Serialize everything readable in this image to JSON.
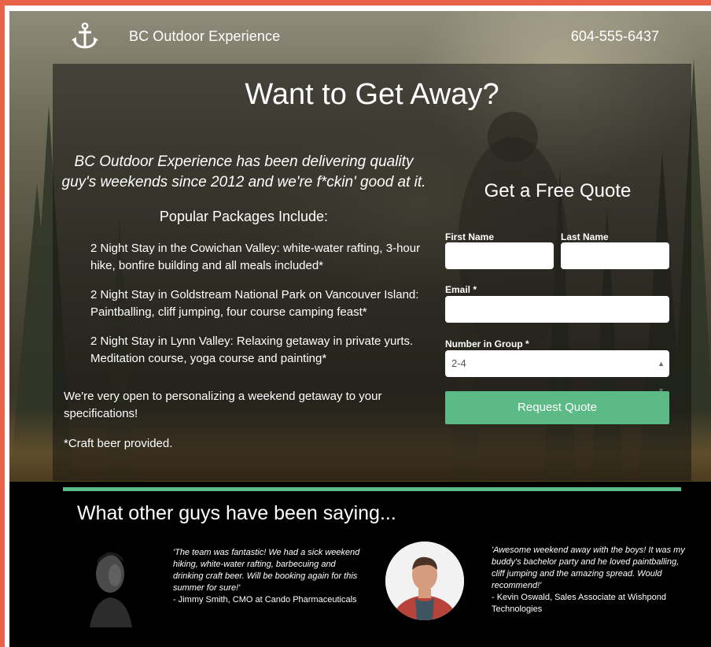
{
  "header": {
    "brand": "BC Outdoor Experience",
    "phone": "604-555-6437",
    "logo_icon": "anchor-icon"
  },
  "hero": {
    "headline": "Want to Get Away?",
    "intro": "BC Outdoor Experience has been delivering quality guy's weekends since 2012 and we're f*ckin' good at it.",
    "packages_title": "Popular Packages Include:",
    "packages": [
      "2 Night Stay in the Cowichan Valley: white-water rafting, 3-hour hike, bonfire building and all meals included*",
      "2 Night Stay in Goldstream National Park on Vancouver Island: Paintballing, cliff jumping, four course camping feast*",
      "2 Night Stay in Lynn Valley: Relaxing getaway in private yurts. Meditation course, yoga course and painting*"
    ],
    "personalize": "We're very open to personalizing a weekend getaway to your specifications!",
    "craft": "*Craft beer provided."
  },
  "form": {
    "title": "Get a Free Quote",
    "first_name_label": "First Name",
    "last_name_label": "Last Name",
    "email_label": "Email *",
    "group_label": "Number in Group *",
    "group_value": "2-4",
    "submit_label": "Request Quote"
  },
  "testimonials": {
    "title": "What other guys have been saying...",
    "items": [
      {
        "quote": "'The team was fantastic! We had a sick weekend hiking, white-water rafting, barbecuing and drinking craft beer. Will be booking again for this summer for sure!'",
        "author": "- Jimmy Smith, CMO at Cando Pharmaceuticals"
      },
      {
        "quote": "'Awesome weekend away with the boys! It was my buddy's bachelor party and he loved paintballing, cliff jumping and the amazing spread. Would recommend!'",
        "author": "- Kevin Oswald, Sales Associate at Wishpond Technologies"
      }
    ]
  },
  "colors": {
    "accent_border": "#e8634a",
    "button_green": "#5cba87"
  }
}
